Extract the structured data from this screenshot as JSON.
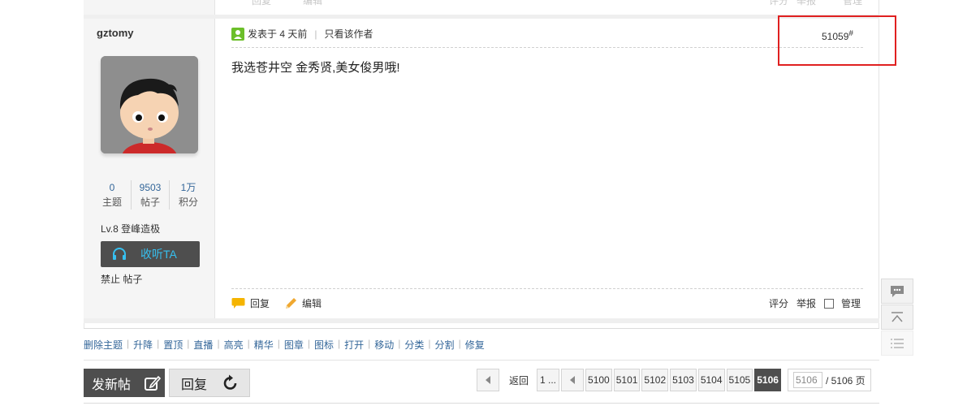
{
  "previous_post": {
    "actions": [
      "回复",
      "编辑"
    ],
    "actions_right": [
      "评分",
      "举报",
      "管理"
    ]
  },
  "author": {
    "username": "gztomy",
    "stats": [
      {
        "value": "0",
        "label": "主题"
      },
      {
        "value": "9503",
        "label": "帖子"
      },
      {
        "value": "1万",
        "label": "积分"
      }
    ],
    "level": "Lv.8 登峰造极",
    "follow_label": "收听TA",
    "ban_links": [
      "禁止",
      "帖子"
    ]
  },
  "post": {
    "posted_time": "发表于 4 天前",
    "author_only": "只看该作者",
    "floor_number": "51059",
    "floor_suffix": "#",
    "content": "我选苍井空 金秀贤,美女俊男哦!",
    "actions": {
      "reply": "回复",
      "edit": "编辑"
    },
    "actions_right": {
      "rate": "评分",
      "report": "举报",
      "manage": "管理"
    }
  },
  "moderation": [
    "删除主题",
    "升降",
    "置顶",
    "直播",
    "高亮",
    "精华",
    "图章",
    "图标",
    "打开",
    "移动",
    "分类",
    "分割",
    "修复"
  ],
  "buttons": {
    "new_post": "发新帖",
    "reply": "回复"
  },
  "pagination": {
    "back": "返回",
    "first": "1 ...",
    "pages": [
      "5100",
      "5101",
      "5102",
      "5103",
      "5104",
      "5105"
    ],
    "current": "5106",
    "input_value": "5106",
    "total": "/ 5106 页"
  },
  "colors": {
    "accent": "#336699",
    "dark_button": "#4e4e4e",
    "follow_text": "#36c0f0",
    "highlight": "#e02020"
  },
  "side_tools": [
    "comment-icon",
    "back-to-top-icon",
    "list-icon"
  ]
}
